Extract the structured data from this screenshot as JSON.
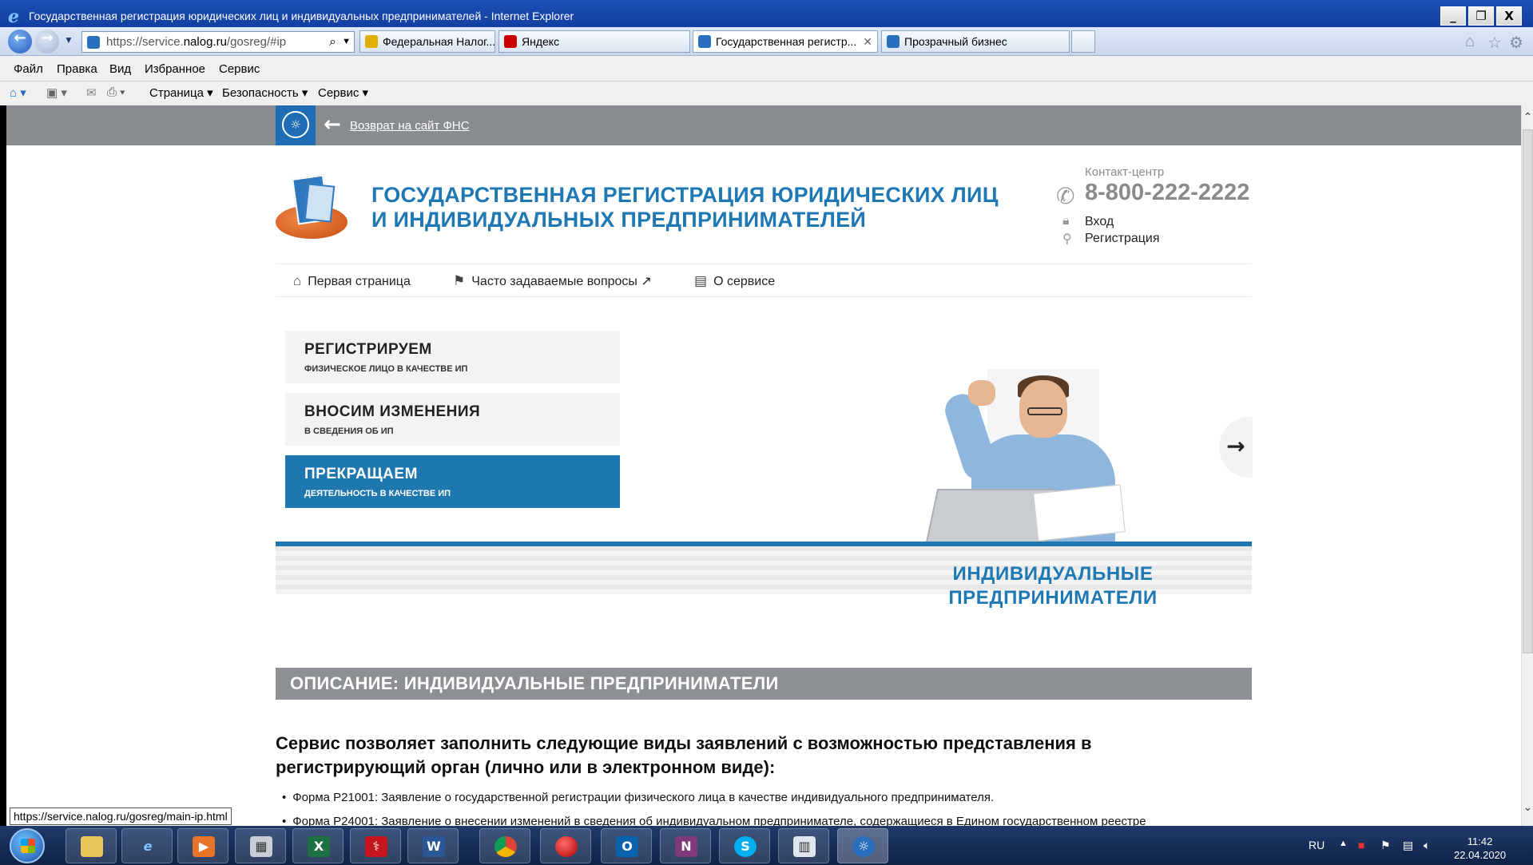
{
  "window": {
    "title": "Государственная регистрация юридических лиц и индивидуальных предпринимателей - Internet Explorer",
    "minimize_glyph": "_",
    "restore_glyph": "❐",
    "close_glyph": "X"
  },
  "navbar": {
    "url_left": "https://service.",
    "url_domain": "nalog.ru",
    "url_right": "/gosreg/#ip",
    "tabs": [
      {
        "label": "Федеральная Налог...",
        "active": false
      },
      {
        "label": "Яндекс",
        "active": false
      },
      {
        "label": "Государственная регистр...",
        "active": true
      },
      {
        "label": "Прозрачный бизнес",
        "active": false
      }
    ]
  },
  "menubar": [
    "Файл",
    "Правка",
    "Вид",
    "Избранное",
    "Сервис"
  ],
  "commandbar": [
    "Страница ▾",
    "Безопасность ▾",
    "Сервис ▾"
  ],
  "page": {
    "fns_back_link": "Возврат на сайт ФНС",
    "site_title_line1": "ГОСУДАРСТВЕННАЯ РЕГИСТРАЦИЯ ЮРИДИЧЕСКИХ ЛИЦ",
    "site_title_line2": "И ИНДИВИДУАЛЬНЫХ ПРЕДПРИНИМАТЕЛЕЙ",
    "contact_label": "Контакт-центр",
    "phone": "8-800-222-2222",
    "login": "Вход",
    "register": "Регистрация",
    "nav": [
      "Первая страница",
      "Часто задаваемые вопросы",
      "О сервисе"
    ],
    "menu_cards": [
      {
        "title": "РЕГИСТРИРУЕМ",
        "subtitle": "ФИЗИЧЕСКОЕ ЛИЦО В КАЧЕСТВЕ ИП",
        "active": false
      },
      {
        "title": "ВНОСИМ ИЗМЕНЕНИЯ",
        "subtitle": "В СВЕДЕНИЯ ОБ ИП",
        "active": false
      },
      {
        "title": "ПРЕКРАЩАЕМ",
        "subtitle": "ДЕЯТЕЛЬНОСТЬ В КАЧЕСТВЕ ИП",
        "active": true
      }
    ],
    "slide_caption_line1": "ИНДИВИДУАЛЬНЫЕ",
    "slide_caption_line2": "ПРЕДПРИНИМАТЕЛИ",
    "section_heading": "ОПИСАНИЕ: ИНДИВИДУАЛЬНЫЕ ПРЕДПРИНИМАТЕЛИ",
    "lead_line1": "Сервис позволяет заполнить следующие виды заявлений с возможностью представления в",
    "lead_line2": "регистрирующий орган (лично или в электронном виде):",
    "bullets": [
      "Форма Р21001: Заявление о государственной регистрации физического лица в качестве индивидуального предпринимателя.",
      "Форма Р24001: Заявление о внесении изменений в сведения об индивидуальном предпринимателе, содержащиеся в Едином государственном реестре"
    ]
  },
  "status_link": "https://service.nalog.ru/gosreg/main-ip.html",
  "taskbar": {
    "lang": "RU",
    "time": "11:42",
    "date": "22.04.2020"
  }
}
